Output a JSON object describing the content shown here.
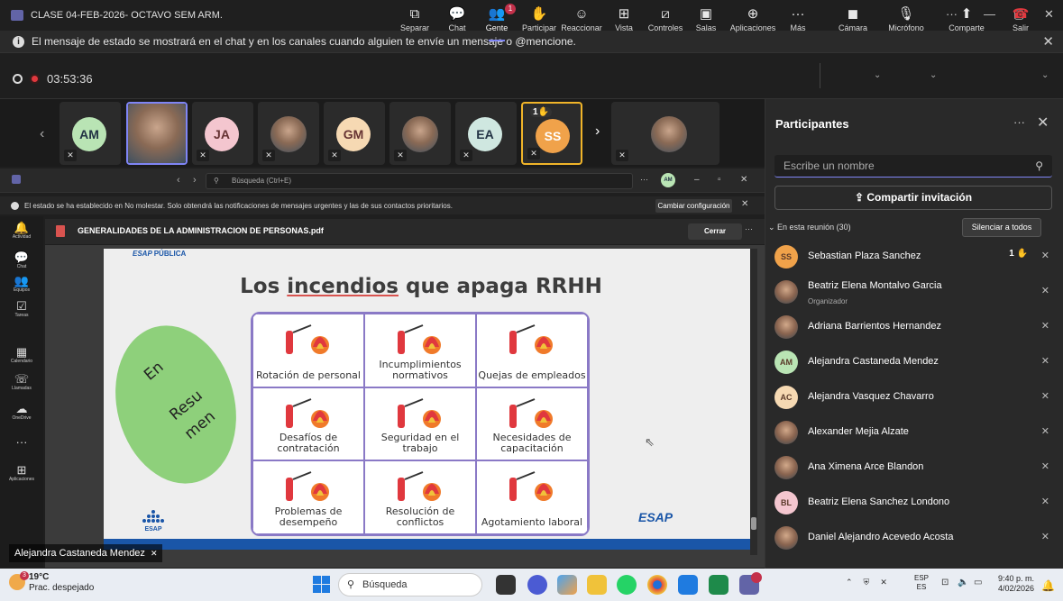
{
  "window": {
    "title": "CLASE 04-FEB-2026- OCTAVO SEM ARM."
  },
  "banner": {
    "message": "El mensaje de estado se mostrará en el chat y en los canales cuando alguien te envíe un mensaje o @mencione."
  },
  "meeting": {
    "timer": "03:53:36"
  },
  "toolbar": {
    "separar": "Separar",
    "chat": "Chat",
    "gente": "Gente",
    "gente_badge": "1",
    "participar": "Participar",
    "reaccionar": "Reaccionar",
    "vista": "Vista",
    "controles": "Controles",
    "salas": "Salas",
    "aplicaciones": "Aplicaciones",
    "mas": "Más",
    "camara": "Cámara",
    "microfono": "Micrófono",
    "comparte": "Comparte",
    "salir": "Salir"
  },
  "strip": {
    "tiles": [
      "AM",
      "JA",
      "GM",
      "EA",
      "SS"
    ],
    "raised_hand": "1"
  },
  "inner": {
    "search_placeholder": "Búsqueda (Ctrl+E)",
    "avatar": "AM",
    "notice": "El estado se ha establecido en No molestar. Solo obtendrá las notificaciones de mensajes urgentes y las de sus contactos prioritarios.",
    "config_button": "Cambiar configuración",
    "rail": [
      "Actividad",
      "Chat",
      "Equipos",
      "Tareas",
      "Calendario",
      "Llamadas",
      "OneDrive",
      "Aplicaciones"
    ],
    "pdf_name": "GENERALIDADES DE LA ADMINISTRACION DE PERSONAS.pdf",
    "close_button": "Cerrar"
  },
  "slide": {
    "header_logo": "PÚBLICA",
    "title_pre": "Los ",
    "title_ul": "incendios",
    "title_post": " que apaga RRHH",
    "ellipse_1": "En",
    "ellipse_2": "Resu",
    "ellipse_3": "men",
    "cells": [
      "Rotación de personal",
      "Incumplimientos normativos",
      "Quejas de empleados",
      "Desafíos de contratación",
      "Seguridad en el trabajo",
      "Necesidades de capacitación",
      "Problemas de desempeño",
      "Resolución de conflictos",
      "Agotamiento laboral"
    ],
    "esap": "ESAP",
    "logo_text": "ESAP"
  },
  "speaker": {
    "name": "Alejandra Castaneda Mendez"
  },
  "panel": {
    "title": "Participantes",
    "search_placeholder": "Escribe un nombre",
    "share_button": "Compartir invitación",
    "in_meeting": "En esta reunión (30)",
    "mute_all": "Silenciar a todos",
    "participants": [
      {
        "initials": "SS",
        "name": "Sebastian Plaza Sanchez",
        "sub": "",
        "hand": "1",
        "color": "#f0a24a"
      },
      {
        "initials": "",
        "name": "Beatriz Elena Montalvo Garcia",
        "sub": "Organizador",
        "hand": "",
        "color": ""
      },
      {
        "initials": "",
        "name": "Adriana Barrientos Hernandez",
        "sub": "",
        "hand": "",
        "color": ""
      },
      {
        "initials": "AM",
        "name": "Alejandra Castaneda Mendez",
        "sub": "",
        "hand": "",
        "color": "#b9e4b4"
      },
      {
        "initials": "AC",
        "name": "Alejandra Vasquez Chavarro",
        "sub": "",
        "hand": "",
        "color": "#f6d9b3"
      },
      {
        "initials": "",
        "name": "Alexander Mejia Alzate",
        "sub": "",
        "hand": "",
        "color": ""
      },
      {
        "initials": "",
        "name": "Ana Ximena Arce Blandon",
        "sub": "",
        "hand": "",
        "color": ""
      },
      {
        "initials": "BL",
        "name": "Beatriz Elena Sanchez Londono",
        "sub": "",
        "hand": "",
        "color": "#f4c6cf"
      },
      {
        "initials": "",
        "name": "Daniel Alejandro Acevedo Acosta",
        "sub": "",
        "hand": "",
        "color": ""
      }
    ]
  },
  "taskbar": {
    "temp": "19°C",
    "weather": "Prac. despejado",
    "weather_badge": "3",
    "search": "Búsqueda",
    "lang1": "ESP",
    "lang2": "ES",
    "time": "9:40 p. m.",
    "date": "4/02/2026"
  }
}
